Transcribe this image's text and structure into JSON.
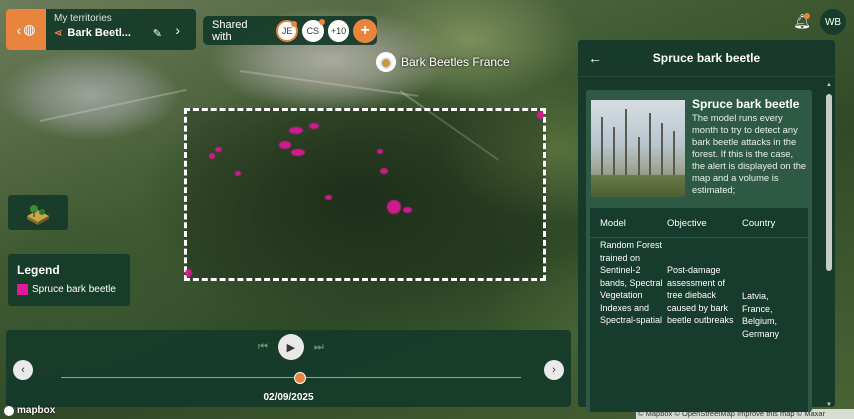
{
  "header": {
    "back_icon": "chevron-left-globe-icon",
    "territories_label": "My territories",
    "territory_name": "Bark Beetl...",
    "shared_label": "Shared with",
    "shared_users": [
      "JE",
      "CS",
      "+10"
    ],
    "add_label": "+",
    "user_initials": "WB"
  },
  "map": {
    "layer_label": "Bark Beetles France",
    "mapbox_logo": "mapbox",
    "attribution": "© Mapbox © OpenStreetMap  Improve this map © Maxar"
  },
  "legend": {
    "title": "Legend",
    "items": [
      {
        "label": "Spruce bark beetle",
        "color": "#e0189b"
      }
    ]
  },
  "timeline": {
    "date": "02/09/2025",
    "position_fraction": 0.52
  },
  "side_panel": {
    "title": "Spruce bark beetle",
    "card_title": "Spruce bark beetle",
    "description": "The model runs every month to try to detect any bark beetle attacks in the forest. If this is the case, the alert is displayed on the map and a volume is estimated;",
    "table": {
      "headers": [
        "Model",
        "Objective",
        "Country"
      ],
      "model": "Random Forest trained on Sentinel-2 bands, Spectral Vegetation Indexes and Spectral-spatial",
      "objective": "Post-damage assessment of tree dieback caused by bark beetle outbreaks",
      "country": "Latvia, France, Belgium, Germany"
    }
  },
  "colors": {
    "accent": "#e8843e",
    "panel": "#173b2d",
    "alert": "#e0189b"
  }
}
